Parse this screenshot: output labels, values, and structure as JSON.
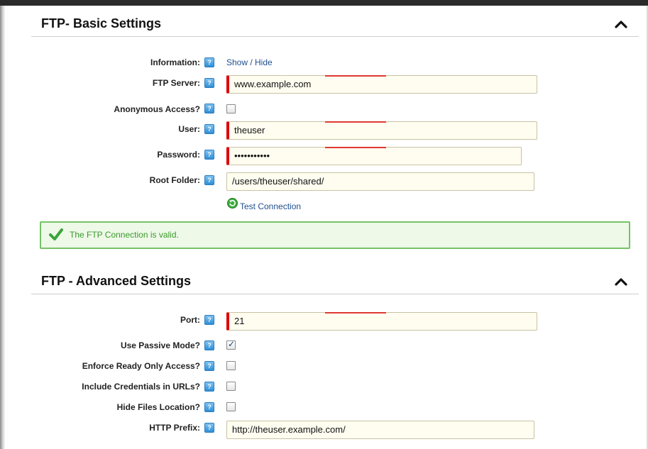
{
  "basic": {
    "title": "FTP- Basic Settings",
    "information_label": "Information:",
    "show_hide": "Show / Hide",
    "server_label": "FTP Server:",
    "server_value": "www.example.com",
    "anonymous_label": "Anonymous Access?",
    "anonymous_checked": false,
    "user_label": "User:",
    "user_value": "theuser",
    "password_label": "Password:",
    "password_mask": "•••••••••••",
    "root_label": "Root Folder:",
    "root_value": "/users/theuser/shared/",
    "test_connection": "Test Connection"
  },
  "status": {
    "message": "The FTP Connection is valid."
  },
  "advanced": {
    "title": "FTP - Advanced Settings",
    "port_label": "Port:",
    "port_value": "21",
    "passive_label": "Use Passive Mode?",
    "passive_checked": true,
    "readonly_label": "Enforce Ready Only Access?",
    "readonly_checked": false,
    "credentials_label": "Include Credentials in URLs?",
    "credentials_checked": false,
    "hide_label": "Hide Files Location?",
    "hide_checked": false,
    "http_prefix_label": "HTTP Prefix:",
    "http_prefix_value": "http://theuser.example.com/"
  },
  "icons": {
    "help": "help-icon",
    "collapse": "chevron-up-icon",
    "refresh": "refresh-icon",
    "check": "checkmark-icon"
  },
  "colors": {
    "required": "#e00000",
    "success_border": "#76c367",
    "success_text": "#3a9a2c",
    "link": "#1f4f8f",
    "field_bg": "#fffdf0"
  },
  "help_glyph": "?"
}
